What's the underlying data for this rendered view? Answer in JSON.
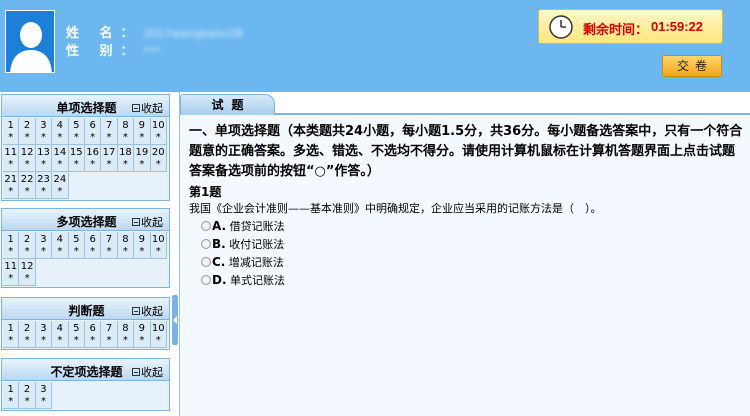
{
  "header": {
    "name_label": "姓 名：",
    "name_value": "2017wangkaiss28",
    "gender_label": "性 别：",
    "gender_value": "***",
    "timer_label": "剩余时间：",
    "timer_value": "01:59:22",
    "submit_label": "交卷"
  },
  "sections": [
    {
      "title": "单项选择题",
      "collapse": "收起",
      "items": [
        {
          "n": "1",
          "s": "*"
        },
        {
          "n": "2",
          "s": "*"
        },
        {
          "n": "3",
          "s": "*"
        },
        {
          "n": "4",
          "s": "*"
        },
        {
          "n": "5",
          "s": "*"
        },
        {
          "n": "6",
          "s": "*"
        },
        {
          "n": "7",
          "s": "*"
        },
        {
          "n": "8",
          "s": "*"
        },
        {
          "n": "9",
          "s": "*"
        },
        {
          "n": "10",
          "s": "*"
        },
        {
          "n": "11",
          "s": "*"
        },
        {
          "n": "12",
          "s": "*"
        },
        {
          "n": "13",
          "s": "*"
        },
        {
          "n": "14",
          "s": "*"
        },
        {
          "n": "15",
          "s": "*"
        },
        {
          "n": "16",
          "s": "*"
        },
        {
          "n": "17",
          "s": "*"
        },
        {
          "n": "18",
          "s": "*"
        },
        {
          "n": "19",
          "s": "*"
        },
        {
          "n": "20",
          "s": "*"
        },
        {
          "n": "21",
          "s": "*"
        },
        {
          "n": "22",
          "s": "*"
        },
        {
          "n": "23",
          "s": "*"
        },
        {
          "n": "24",
          "s": "*"
        }
      ]
    },
    {
      "title": "多项选择题",
      "collapse": "收起",
      "items": [
        {
          "n": "1",
          "s": "*"
        },
        {
          "n": "2",
          "s": "*"
        },
        {
          "n": "3",
          "s": "*"
        },
        {
          "n": "4",
          "s": "*"
        },
        {
          "n": "5",
          "s": "*"
        },
        {
          "n": "6",
          "s": "*"
        },
        {
          "n": "7",
          "s": "*"
        },
        {
          "n": "8",
          "s": "*"
        },
        {
          "n": "9",
          "s": "*"
        },
        {
          "n": "10",
          "s": "*"
        },
        {
          "n": "11",
          "s": "*"
        },
        {
          "n": "12",
          "s": "*"
        }
      ]
    },
    {
      "title": "判断题",
      "collapse": "收起",
      "items": [
        {
          "n": "1",
          "s": "*"
        },
        {
          "n": "2",
          "s": "*"
        },
        {
          "n": "3",
          "s": "*"
        },
        {
          "n": "4",
          "s": "*"
        },
        {
          "n": "5",
          "s": "*"
        },
        {
          "n": "6",
          "s": "*"
        },
        {
          "n": "7",
          "s": "*"
        },
        {
          "n": "8",
          "s": "*"
        },
        {
          "n": "9",
          "s": "*"
        },
        {
          "n": "10",
          "s": "*"
        }
      ]
    },
    {
      "title": "不定项选择题",
      "collapse": "收起",
      "items": [
        {
          "n": "1",
          "s": "*"
        },
        {
          "n": "2",
          "s": "*"
        },
        {
          "n": "3",
          "s": "*"
        }
      ]
    }
  ],
  "main": {
    "tab_label": "试题",
    "instructions": "一、单项选择题（本类题共24小题，每小题1.5分，共36分。每小题备选答案中，只有一个符合题意的正确答案。多选、错选、不选均不得分。请使用计算机鼠标在计算机答题界面上点击试题答案备选项前的按钮“○”作答。）",
    "question_number": "第1题",
    "question_text": "我国《企业会计准则——基本准则》中明确规定，企业应当采用的记账方法是（　）。",
    "options": [
      {
        "letter": "A.",
        "text": "借贷记账法"
      },
      {
        "letter": "B.",
        "text": "收付记账法"
      },
      {
        "letter": "C.",
        "text": "增减记账法"
      },
      {
        "letter": "D.",
        "text": "单式记账法"
      }
    ]
  }
}
